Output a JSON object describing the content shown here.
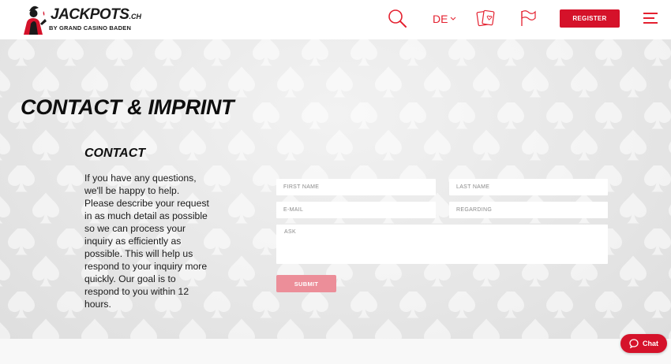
{
  "brand": {
    "name": "JACKPOTS",
    "tld": ".CH",
    "tagline": "BY GRAND CASINO BADEN",
    "primary_color": "#d5122a",
    "accent_color": "#e4202f"
  },
  "header": {
    "search_icon": "search-icon",
    "language": "DE",
    "cards_icon": "cards-icon",
    "flag_icon": "flag-icon",
    "register_label": "REGISTER",
    "menu_icon": "hamburger-menu-icon"
  },
  "page": {
    "title": "CONTACT & IMPRINT"
  },
  "contact": {
    "heading": "CONTACT",
    "text": "If you have any questions, we'll be happy to help. Please describe your request in as much detail as possible so we can process your inquiry as efficiently as possible. This will help us respond to your inquiry more quickly. Our goal is to respond to you within 12 hours."
  },
  "form": {
    "first_name_placeholder": "FIRST NAME",
    "last_name_placeholder": "LAST NAME",
    "email_placeholder": "E-MAIL",
    "regarding_placeholder": "REGARDING",
    "ask_placeholder": "ASK",
    "submit_label": "SUBMIT"
  },
  "chat": {
    "label": "Chat"
  }
}
